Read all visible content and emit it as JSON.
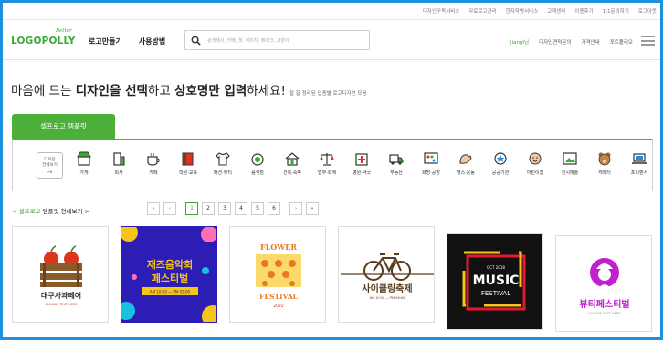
{
  "top_links": [
    "디자인구독서비스",
    "무료로고관리",
    "한자작명서비스",
    "고객센터",
    "이용후기",
    "1:1문의하기",
    "로그아웃"
  ],
  "logo": {
    "name": "LOGOPOLLY",
    "tagline": "Better"
  },
  "nav": [
    "로고만들기",
    "사용방법"
  ],
  "search": {
    "placeholder": "검색해서, 카페, 꽃, 이미지, 메이크, 고양이"
  },
  "header_right": {
    "user": "jiangl님",
    "items": [
      "디자인견적문의",
      "가격안내",
      "포트폴리오"
    ]
  },
  "headline": {
    "part1": "마음에 드는 ",
    "bold1": "디자인을 선택",
    "part2": "하고 ",
    "bold2": "상호명만 입력",
    "part3": "하세요!",
    "sub": "잘 잘 정리된 업종별 로고디자인 모음"
  },
  "tab_label": "셀프로고 템플릿",
  "all_button": {
    "line1": "디자인",
    "line2": "전체보기",
    "arrow": "→"
  },
  "categories": [
    {
      "label": "가게",
      "icon": "store-icon"
    },
    {
      "label": "회사",
      "icon": "building-icon"
    },
    {
      "label": "카페",
      "icon": "coffee-icon"
    },
    {
      "label": "학원·교육",
      "icon": "book-icon"
    },
    {
      "label": "패션·뷰티",
      "icon": "shirt-icon"
    },
    {
      "label": "음식점",
      "icon": "dish-icon"
    },
    {
      "label": "건축·숙박",
      "icon": "house-icon"
    },
    {
      "label": "법무·회계",
      "icon": "scale-icon"
    },
    {
      "label": "병원·약국",
      "icon": "hospital-icon"
    },
    {
      "label": "부동산",
      "icon": "truck-icon"
    },
    {
      "label": "화방·공방",
      "icon": "palette-icon"
    },
    {
      "label": "헬스·운동",
      "icon": "muscle-icon"
    },
    {
      "label": "공공기관",
      "icon": "emblem-icon"
    },
    {
      "label": "어린이집",
      "icon": "baby-icon"
    },
    {
      "label": "전시예술",
      "icon": "gallery-icon"
    },
    {
      "label": "캐릭터",
      "icon": "bear-icon"
    },
    {
      "label": "프리랜서",
      "icon": "laptop-icon"
    }
  ],
  "template_link": {
    "green": "< 셀프로고",
    "rest": " 템플릿 전체보기 >"
  },
  "pagination": {
    "first": "«",
    "prev": "‹",
    "pages": [
      "1",
      "2",
      "3",
      "4",
      "5",
      "6"
    ],
    "active": "1",
    "next": "›",
    "last": "»"
  },
  "templates": [
    {
      "name": "대구사과페어",
      "sub": "SLOGAN TEXT HERE",
      "color": "#c0392b"
    },
    {
      "name": "재즈음악회 페스티벌",
      "sub": "AM 10:00 — PM 05:00",
      "color": "#2c1db5"
    },
    {
      "name": "FLOWER FESTIVAL",
      "sub": "2022",
      "color": "#e87a1d"
    },
    {
      "name": "사이클링축제",
      "sub": "AM 10:00 — PM 06:00",
      "color": "#5a3a1c"
    },
    {
      "name": "MUSIC FESTIVAL",
      "sub": "OCT 2018",
      "color": "#111111"
    },
    {
      "name": "뷰티페스티벌",
      "sub": "SLOGAN TEXT HERE",
      "color": "#c21fcf"
    }
  ]
}
